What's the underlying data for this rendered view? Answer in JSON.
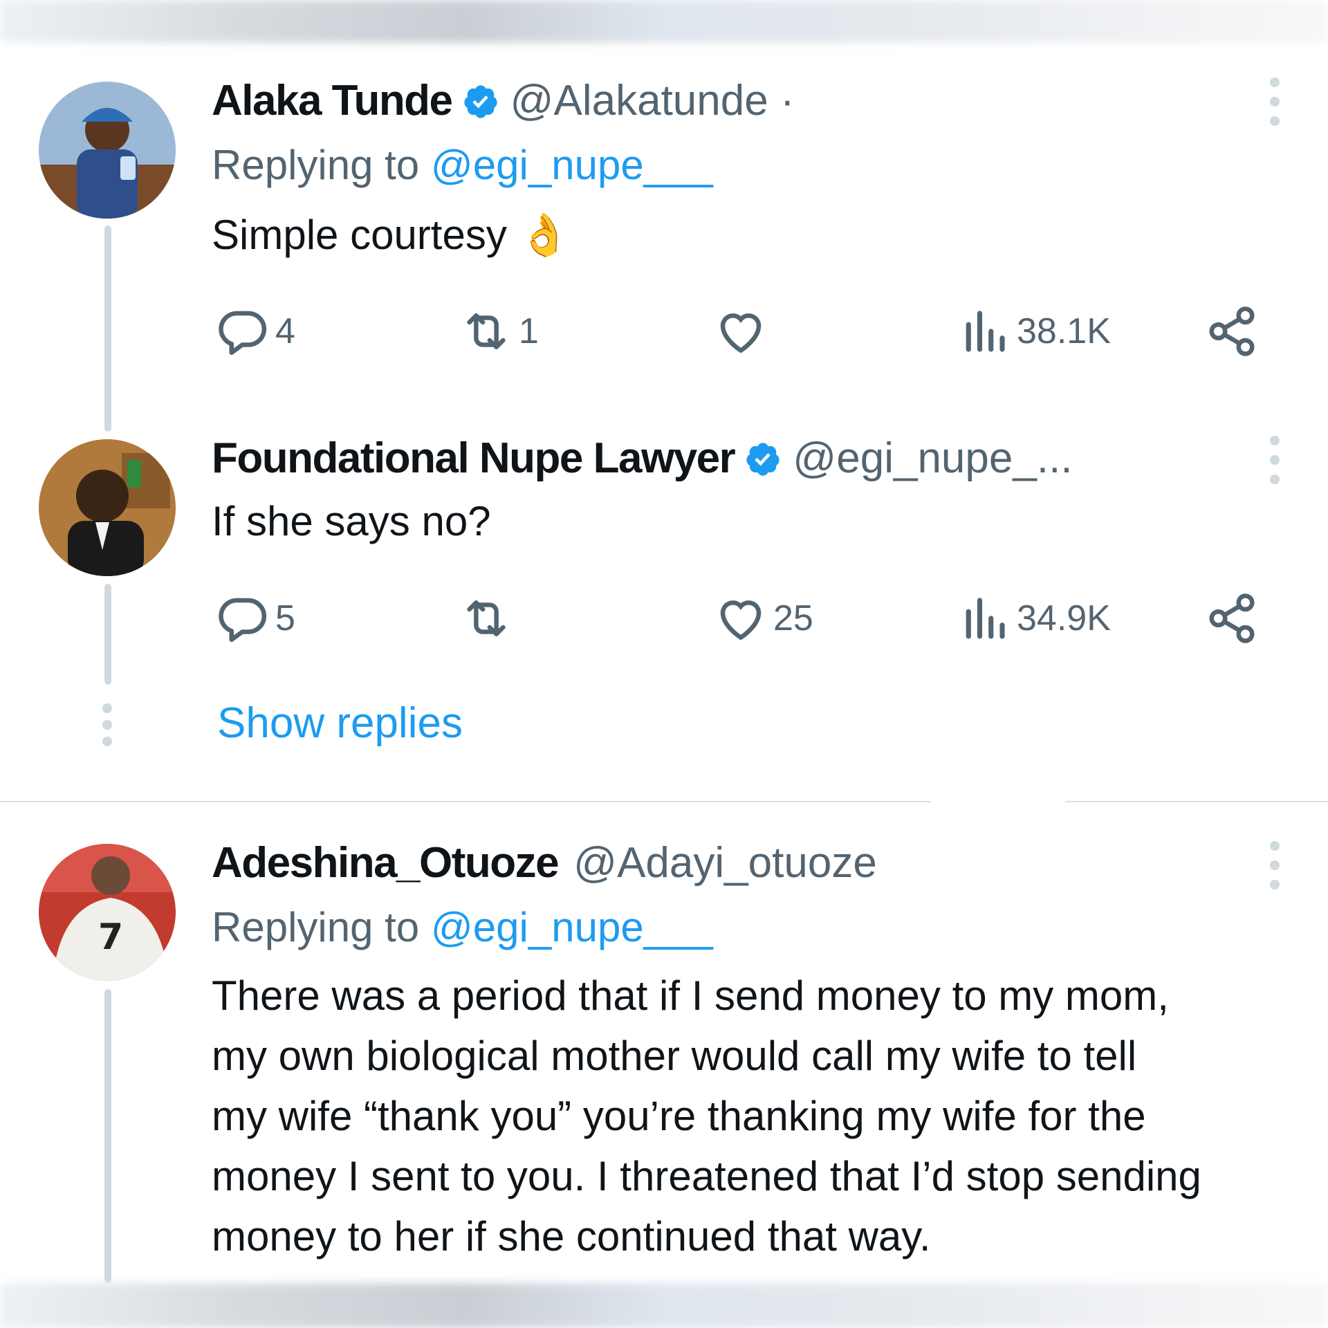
{
  "tweets": [
    {
      "name": "Alaka Tunde",
      "verified": true,
      "handle": "@Alakatunde ·",
      "replying_prefix": "Replying to ",
      "replying_to": "@egi_nupe___",
      "text": "Simple courtesy 👌",
      "replies": "4",
      "retweets": "1",
      "likes": "",
      "views": "38.1K",
      "avatar_icon": "avatar-engineer-illustration"
    },
    {
      "name": "Foundational Nupe Lawyer",
      "verified": true,
      "handle": "@egi_nupe_...",
      "text": "If she says no?",
      "replies": "5",
      "retweets": "",
      "likes": "25",
      "views": "34.9K",
      "avatar_icon": "avatar-lawyer-illustration"
    },
    {
      "name": "Adeshina_Otuoze",
      "verified": false,
      "handle": "@Adayi_otuoze",
      "replying_prefix": "Replying to ",
      "replying_to": "@egi_nupe___",
      "text_lines": [
        "There was a period that if I send money to my mom,",
        "my own biological mother would call my wife to tell",
        "my wife “thank you” you’re thanking my wife for the",
        "money I sent to you. I threatened that I’d stop sending",
        "money to her if she continued that way."
      ],
      "avatar_icon": "avatar-footballer-photo"
    }
  ],
  "thread": {
    "show_replies": "Show replies"
  },
  "colors": {
    "accent": "#1d9bf0",
    "secondary_text": "#536471",
    "thread_line": "#cfd9de"
  }
}
